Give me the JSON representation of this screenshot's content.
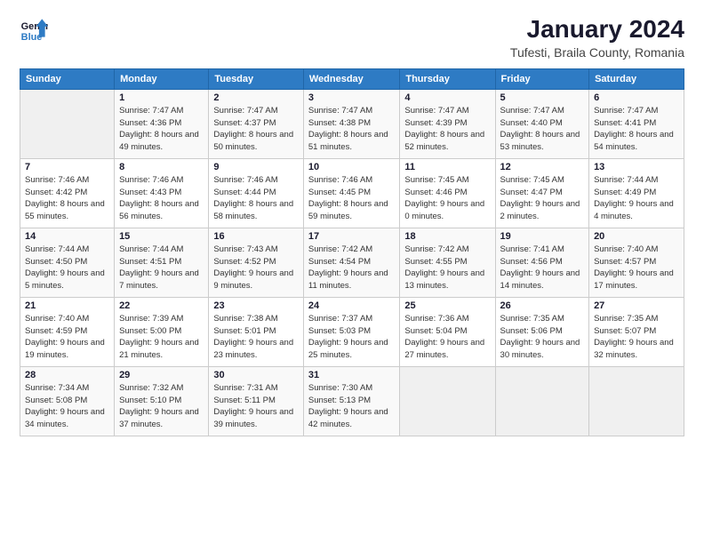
{
  "header": {
    "logo_line1": "General",
    "logo_line2": "Blue",
    "title": "January 2024",
    "subtitle": "Tufesti, Braila County, Romania"
  },
  "weekdays": [
    "Sunday",
    "Monday",
    "Tuesday",
    "Wednesday",
    "Thursday",
    "Friday",
    "Saturday"
  ],
  "weeks": [
    [
      {
        "num": "",
        "sunrise": "",
        "sunset": "",
        "daylight": ""
      },
      {
        "num": "1",
        "sunrise": "Sunrise: 7:47 AM",
        "sunset": "Sunset: 4:36 PM",
        "daylight": "Daylight: 8 hours and 49 minutes."
      },
      {
        "num": "2",
        "sunrise": "Sunrise: 7:47 AM",
        "sunset": "Sunset: 4:37 PM",
        "daylight": "Daylight: 8 hours and 50 minutes."
      },
      {
        "num": "3",
        "sunrise": "Sunrise: 7:47 AM",
        "sunset": "Sunset: 4:38 PM",
        "daylight": "Daylight: 8 hours and 51 minutes."
      },
      {
        "num": "4",
        "sunrise": "Sunrise: 7:47 AM",
        "sunset": "Sunset: 4:39 PM",
        "daylight": "Daylight: 8 hours and 52 minutes."
      },
      {
        "num": "5",
        "sunrise": "Sunrise: 7:47 AM",
        "sunset": "Sunset: 4:40 PM",
        "daylight": "Daylight: 8 hours and 53 minutes."
      },
      {
        "num": "6",
        "sunrise": "Sunrise: 7:47 AM",
        "sunset": "Sunset: 4:41 PM",
        "daylight": "Daylight: 8 hours and 54 minutes."
      }
    ],
    [
      {
        "num": "7",
        "sunrise": "Sunrise: 7:46 AM",
        "sunset": "Sunset: 4:42 PM",
        "daylight": "Daylight: 8 hours and 55 minutes."
      },
      {
        "num": "8",
        "sunrise": "Sunrise: 7:46 AM",
        "sunset": "Sunset: 4:43 PM",
        "daylight": "Daylight: 8 hours and 56 minutes."
      },
      {
        "num": "9",
        "sunrise": "Sunrise: 7:46 AM",
        "sunset": "Sunset: 4:44 PM",
        "daylight": "Daylight: 8 hours and 58 minutes."
      },
      {
        "num": "10",
        "sunrise": "Sunrise: 7:46 AM",
        "sunset": "Sunset: 4:45 PM",
        "daylight": "Daylight: 8 hours and 59 minutes."
      },
      {
        "num": "11",
        "sunrise": "Sunrise: 7:45 AM",
        "sunset": "Sunset: 4:46 PM",
        "daylight": "Daylight: 9 hours and 0 minutes."
      },
      {
        "num": "12",
        "sunrise": "Sunrise: 7:45 AM",
        "sunset": "Sunset: 4:47 PM",
        "daylight": "Daylight: 9 hours and 2 minutes."
      },
      {
        "num": "13",
        "sunrise": "Sunrise: 7:44 AM",
        "sunset": "Sunset: 4:49 PM",
        "daylight": "Daylight: 9 hours and 4 minutes."
      }
    ],
    [
      {
        "num": "14",
        "sunrise": "Sunrise: 7:44 AM",
        "sunset": "Sunset: 4:50 PM",
        "daylight": "Daylight: 9 hours and 5 minutes."
      },
      {
        "num": "15",
        "sunrise": "Sunrise: 7:44 AM",
        "sunset": "Sunset: 4:51 PM",
        "daylight": "Daylight: 9 hours and 7 minutes."
      },
      {
        "num": "16",
        "sunrise": "Sunrise: 7:43 AM",
        "sunset": "Sunset: 4:52 PM",
        "daylight": "Daylight: 9 hours and 9 minutes."
      },
      {
        "num": "17",
        "sunrise": "Sunrise: 7:42 AM",
        "sunset": "Sunset: 4:54 PM",
        "daylight": "Daylight: 9 hours and 11 minutes."
      },
      {
        "num": "18",
        "sunrise": "Sunrise: 7:42 AM",
        "sunset": "Sunset: 4:55 PM",
        "daylight": "Daylight: 9 hours and 13 minutes."
      },
      {
        "num": "19",
        "sunrise": "Sunrise: 7:41 AM",
        "sunset": "Sunset: 4:56 PM",
        "daylight": "Daylight: 9 hours and 14 minutes."
      },
      {
        "num": "20",
        "sunrise": "Sunrise: 7:40 AM",
        "sunset": "Sunset: 4:57 PM",
        "daylight": "Daylight: 9 hours and 17 minutes."
      }
    ],
    [
      {
        "num": "21",
        "sunrise": "Sunrise: 7:40 AM",
        "sunset": "Sunset: 4:59 PM",
        "daylight": "Daylight: 9 hours and 19 minutes."
      },
      {
        "num": "22",
        "sunrise": "Sunrise: 7:39 AM",
        "sunset": "Sunset: 5:00 PM",
        "daylight": "Daylight: 9 hours and 21 minutes."
      },
      {
        "num": "23",
        "sunrise": "Sunrise: 7:38 AM",
        "sunset": "Sunset: 5:01 PM",
        "daylight": "Daylight: 9 hours and 23 minutes."
      },
      {
        "num": "24",
        "sunrise": "Sunrise: 7:37 AM",
        "sunset": "Sunset: 5:03 PM",
        "daylight": "Daylight: 9 hours and 25 minutes."
      },
      {
        "num": "25",
        "sunrise": "Sunrise: 7:36 AM",
        "sunset": "Sunset: 5:04 PM",
        "daylight": "Daylight: 9 hours and 27 minutes."
      },
      {
        "num": "26",
        "sunrise": "Sunrise: 7:35 AM",
        "sunset": "Sunset: 5:06 PM",
        "daylight": "Daylight: 9 hours and 30 minutes."
      },
      {
        "num": "27",
        "sunrise": "Sunrise: 7:35 AM",
        "sunset": "Sunset: 5:07 PM",
        "daylight": "Daylight: 9 hours and 32 minutes."
      }
    ],
    [
      {
        "num": "28",
        "sunrise": "Sunrise: 7:34 AM",
        "sunset": "Sunset: 5:08 PM",
        "daylight": "Daylight: 9 hours and 34 minutes."
      },
      {
        "num": "29",
        "sunrise": "Sunrise: 7:32 AM",
        "sunset": "Sunset: 5:10 PM",
        "daylight": "Daylight: 9 hours and 37 minutes."
      },
      {
        "num": "30",
        "sunrise": "Sunrise: 7:31 AM",
        "sunset": "Sunset: 5:11 PM",
        "daylight": "Daylight: 9 hours and 39 minutes."
      },
      {
        "num": "31",
        "sunrise": "Sunrise: 7:30 AM",
        "sunset": "Sunset: 5:13 PM",
        "daylight": "Daylight: 9 hours and 42 minutes."
      },
      {
        "num": "",
        "sunrise": "",
        "sunset": "",
        "daylight": ""
      },
      {
        "num": "",
        "sunrise": "",
        "sunset": "",
        "daylight": ""
      },
      {
        "num": "",
        "sunrise": "",
        "sunset": "",
        "daylight": ""
      }
    ]
  ]
}
